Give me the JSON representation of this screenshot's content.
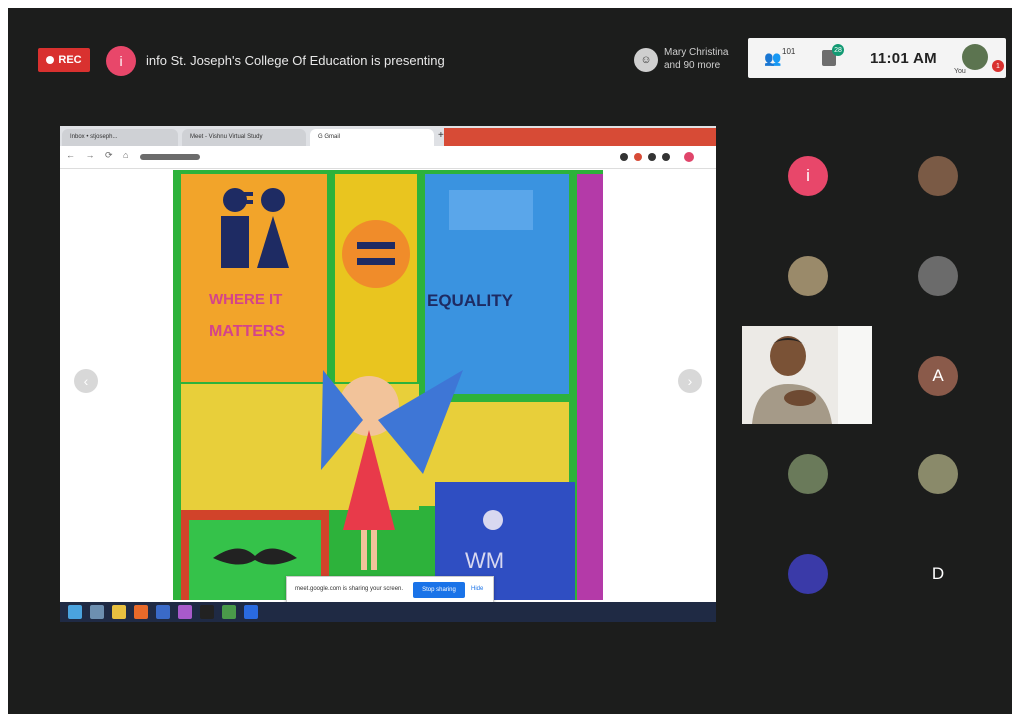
{
  "meeting": {
    "rec_label": "REC",
    "presenter_initial": "i",
    "presenting_text": "info St. Joseph's College Of Education is presenting",
    "pinned_names": [
      "Mary Christina",
      "and 90 more"
    ],
    "people_count": "101",
    "chat_count": "28",
    "time": "11:01 AM",
    "self_label": "You",
    "self_badge": "1"
  },
  "shared_screen": {
    "tabs": [
      "Inbox • stjoseph...",
      "Meet - Vishnu Virtual Study",
      "G Gmail"
    ],
    "slide_texts": [
      "WHERE IT",
      "MATTERS",
      "EQUALITY"
    ],
    "sharing_prompt": "meet.google.com is sharing your screen.",
    "stop_label": "Stop sharing",
    "hide_label": "Hide"
  },
  "participants": [
    {
      "initial": "i",
      "color": "#e8476a"
    },
    {
      "initial": "",
      "color": "#7a5a45"
    },
    {
      "initial": "",
      "color": "#9a8a6a"
    },
    {
      "initial": "",
      "color": "#6b6b6b"
    },
    {
      "initial": "A",
      "color": "#e8476a"
    },
    {
      "initial": "",
      "color": "#8a5a4a"
    },
    {
      "initial": "",
      "color": "#6a7a5a"
    },
    {
      "initial": "",
      "color": "#8a8a6a"
    },
    {
      "initial": "D",
      "color": "#3a3aa8"
    }
  ]
}
